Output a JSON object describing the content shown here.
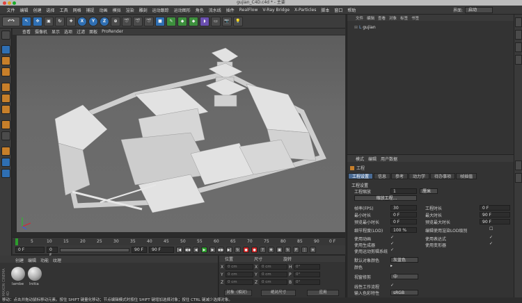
{
  "window": {
    "title": "gujian_C4D.c4d * - 主要"
  },
  "menubar": {
    "items": [
      "文件",
      "编辑",
      "创建",
      "选择",
      "工具",
      "网格",
      "捕捉",
      "动画",
      "模拟",
      "渲染",
      "雕刻",
      "运动跟踪",
      "运动图形",
      "角色",
      "流水线",
      "插件",
      "RealFlow",
      "V-Ray Bridge",
      "X-Particles",
      "脚本",
      "窗口",
      "帮助"
    ],
    "layout_label": "界面:",
    "layout_value": "启动"
  },
  "toolbar": {
    "axis_labels": [
      "X",
      "Y",
      "Z"
    ]
  },
  "viewport": {
    "menu": [
      "查看",
      "摄像机",
      "显示",
      "选项",
      "过滤",
      "面板",
      "ProRender"
    ]
  },
  "timeline": {
    "ticks": [
      "0",
      "5",
      "10",
      "15",
      "20",
      "25",
      "30",
      "35",
      "40",
      "45",
      "50",
      "55",
      "60",
      "65",
      "70",
      "75",
      "80",
      "85",
      "90"
    ],
    "end_label": "0 F",
    "start_field": "0 F",
    "min_field": "0 F",
    "max_field": "90 F",
    "end_field": "90 F"
  },
  "material_manager": {
    "menu": [
      "创建",
      "编辑",
      "功能",
      "纹理"
    ],
    "materials": [
      "lambe",
      "Initia"
    ],
    "watermark": "MAXON CINEMA 4D"
  },
  "coordinates": {
    "headers": [
      "位置",
      "尺寸",
      "旋转"
    ],
    "rows": [
      {
        "axis": "X",
        "pos": "0 cm",
        "size": "0 cm",
        "rot_label": "H",
        "rot": "0°"
      },
      {
        "axis": "Y",
        "pos": "0 cm",
        "size": "0 cm",
        "rot_label": "P",
        "rot": "0°"
      },
      {
        "axis": "Z",
        "pos": "0 cm",
        "size": "0 cm",
        "rot_label": "B",
        "rot": "0°"
      }
    ],
    "mode_select": "对象（相对）",
    "size_select": "绝对尺寸",
    "apply_label": "应用"
  },
  "object_manager": {
    "menu": [
      "文件",
      "编辑",
      "查看",
      "对象",
      "标签",
      "书签"
    ],
    "objects": [
      "gujian"
    ]
  },
  "attribute_manager": {
    "menu": [
      "模式",
      "编辑",
      "用户数据"
    ],
    "title": "工程",
    "tabs": [
      "工程设置",
      "信息",
      "参考",
      "动力学",
      "待办事项",
      "帧插值"
    ],
    "section": "工程设置",
    "scale_label": "工程缩放",
    "scale_value": "1",
    "scale_unit": "厘米",
    "scale_button": "缩放工程...",
    "fps_label": "帧率(FPS)",
    "fps_value": "30",
    "project_time_label": "工程时长",
    "project_time_value": "0 F",
    "min_time_label": "最小时长",
    "min_time_value": "0 F",
    "max_time_label": "最大时长",
    "max_time_value": "90 F",
    "preview_min_label": "预览最小时长",
    "preview_min_value": "0 F",
    "preview_max_label": "预览最大时长",
    "preview_max_value": "90 F",
    "lod_label": "细节程度(LOD)",
    "lod_value": "100 %",
    "lod_render_label": "编辑使用渲染LOD级别",
    "use_anim_label": "使用动画",
    "use_expr_label": "使用表达式",
    "use_gen_label": "使用生成器",
    "use_deform_label": "使用变形器",
    "use_motion_label": "使用运动剪辑系统",
    "default_color_label": "默认对象颜色",
    "default_color_value": "灰蓝色",
    "color_label": "颜色",
    "view_clip_label": "视窗修剪",
    "view_clip_value": "中",
    "linear_flow_label": "线性工作流程",
    "input_color_label": "输入色彩特性",
    "input_color_value": "sRGB"
  },
  "status": {
    "text": "移动：点击并拖动鼠标移动元素。按住 SHIFT 键量化移动；节点编辑模式时按住 SHIFT 键增加选择对象；按住 CTRL 键减少选择对象。"
  }
}
